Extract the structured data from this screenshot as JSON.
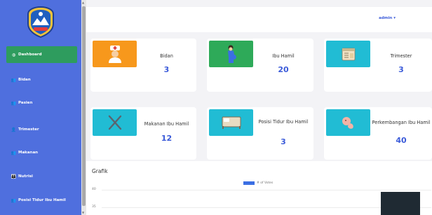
{
  "sidebar": {
    "items": [
      {
        "label": "Dashboard",
        "icon": "dashboard-icon",
        "active": true
      },
      {
        "label": "Bidan",
        "icon": "users-icon"
      },
      {
        "label": "Pasien",
        "icon": "users-icon"
      },
      {
        "label": "Trimester",
        "icon": "user-icon"
      },
      {
        "label": "Makanan",
        "icon": "users-icon"
      },
      {
        "label": "Nutrisi",
        "icon": "user-group-icon"
      },
      {
        "label": "Posisi Tidur Ibu Hamil",
        "icon": "users-icon"
      }
    ]
  },
  "topbar": {
    "user": "admin ▾"
  },
  "cards": [
    {
      "label": "Bidan",
      "value": "3",
      "color": "#f7981c",
      "icon": "nurse-icon"
    },
    {
      "label": "Ibu Hamil",
      "value": "20",
      "color": "#2eaa59",
      "icon": "pregnant-woman-icon"
    },
    {
      "label": "Trimester",
      "value": "3",
      "color": "#21bcd4",
      "icon": "calendar-icon"
    },
    {
      "label": "Makanan Ibu Hamil",
      "value": "12",
      "color": "#21bcd4",
      "icon": "fork-knife-icon"
    },
    {
      "label": "Posisi Tidur Ibu Hamil",
      "value": "3",
      "color": "#21bcd4",
      "icon": "bed-icon"
    },
    {
      "label": "Perkembangan Ibu Hamil",
      "value": "40",
      "color": "#21bcd4",
      "icon": "fetus-icon"
    }
  ],
  "chart": {
    "title": "Grafik",
    "legend": "# of Votes",
    "ticks": [
      "40",
      "35"
    ]
  },
  "colors": {
    "sidebar": "#4f6fde",
    "active": "#2e9c5e",
    "accent": "#3b5bd9"
  }
}
